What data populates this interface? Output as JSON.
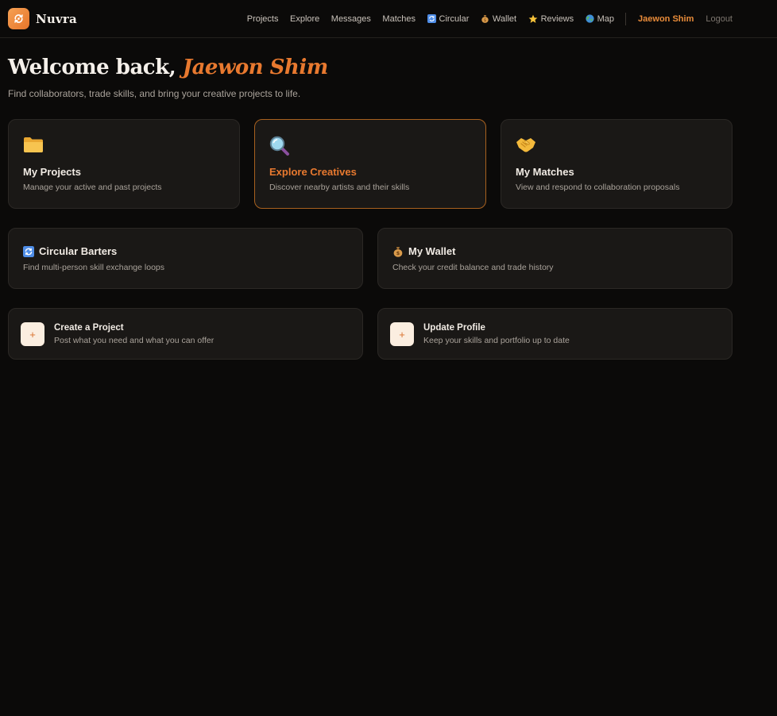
{
  "brand": {
    "name": "Nuvra",
    "logo_icon": "cycle-icon",
    "accent": "#e8792f"
  },
  "nav": {
    "items": [
      {
        "label": "Projects",
        "icon": ""
      },
      {
        "label": "Explore",
        "icon": ""
      },
      {
        "label": "Messages",
        "icon": ""
      },
      {
        "label": "Matches",
        "icon": ""
      },
      {
        "label": "Circular",
        "icon": "cycle-arrows-icon"
      },
      {
        "label": "Wallet",
        "icon": "money-bag-icon"
      },
      {
        "label": "Reviews",
        "icon": "star-icon"
      },
      {
        "label": "Map",
        "icon": "globe-icon"
      }
    ],
    "user": "Jaewon Shim",
    "logout": "Logout"
  },
  "welcome": {
    "greeting": "Welcome back,",
    "name": "Jaewon Shim",
    "subtitle": "Find collaborators, trade skills, and bring your creative projects to life."
  },
  "cards": [
    {
      "title": "My Projects",
      "desc": "Manage your active and past projects",
      "icon": "folder-icon"
    },
    {
      "title": "Explore Creatives",
      "desc": "Discover nearby artists and their skills",
      "icon": "magnifier-icon"
    },
    {
      "title": "My Matches",
      "desc": "View and respond to collaboration proposals",
      "icon": "handshake-icon"
    }
  ],
  "wide_cards": [
    {
      "title": "Circular Barters",
      "desc": "Find multi-person skill exchange loops",
      "icon": "cycle-arrows-icon"
    },
    {
      "title": "My Wallet",
      "desc": "Check your credit balance and trade history",
      "icon": "money-bag-icon"
    }
  ],
  "actions": [
    {
      "plus": "+",
      "title": "Create a Project",
      "desc": "Post what you need and what you can offer"
    },
    {
      "plus": "+",
      "title": "Update Profile",
      "desc": "Keep your skills and portfolio up to date"
    }
  ]
}
